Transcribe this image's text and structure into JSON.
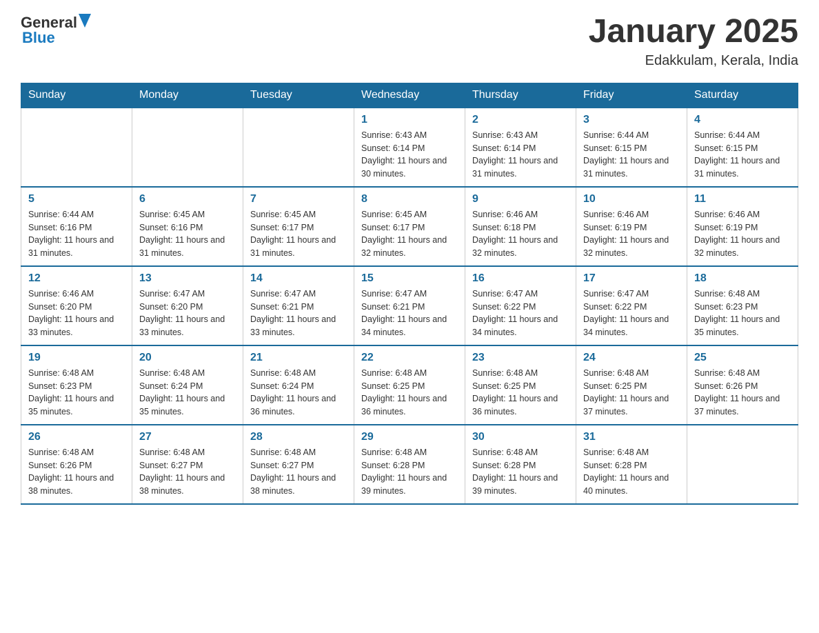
{
  "header": {
    "logo_general": "General",
    "logo_blue": "Blue",
    "month_title": "January 2025",
    "location": "Edakkulam, Kerala, India"
  },
  "days_of_week": [
    "Sunday",
    "Monday",
    "Tuesday",
    "Wednesday",
    "Thursday",
    "Friday",
    "Saturday"
  ],
  "weeks": [
    [
      {
        "day": null
      },
      {
        "day": null
      },
      {
        "day": null
      },
      {
        "day": "1",
        "sunrise": "6:43 AM",
        "sunset": "6:14 PM",
        "daylight": "11 hours and 30 minutes."
      },
      {
        "day": "2",
        "sunrise": "6:43 AM",
        "sunset": "6:14 PM",
        "daylight": "11 hours and 31 minutes."
      },
      {
        "day": "3",
        "sunrise": "6:44 AM",
        "sunset": "6:15 PM",
        "daylight": "11 hours and 31 minutes."
      },
      {
        "day": "4",
        "sunrise": "6:44 AM",
        "sunset": "6:15 PM",
        "daylight": "11 hours and 31 minutes."
      }
    ],
    [
      {
        "day": "5",
        "sunrise": "6:44 AM",
        "sunset": "6:16 PM",
        "daylight": "11 hours and 31 minutes."
      },
      {
        "day": "6",
        "sunrise": "6:45 AM",
        "sunset": "6:16 PM",
        "daylight": "11 hours and 31 minutes."
      },
      {
        "day": "7",
        "sunrise": "6:45 AM",
        "sunset": "6:17 PM",
        "daylight": "11 hours and 31 minutes."
      },
      {
        "day": "8",
        "sunrise": "6:45 AM",
        "sunset": "6:17 PM",
        "daylight": "11 hours and 32 minutes."
      },
      {
        "day": "9",
        "sunrise": "6:46 AM",
        "sunset": "6:18 PM",
        "daylight": "11 hours and 32 minutes."
      },
      {
        "day": "10",
        "sunrise": "6:46 AM",
        "sunset": "6:19 PM",
        "daylight": "11 hours and 32 minutes."
      },
      {
        "day": "11",
        "sunrise": "6:46 AM",
        "sunset": "6:19 PM",
        "daylight": "11 hours and 32 minutes."
      }
    ],
    [
      {
        "day": "12",
        "sunrise": "6:46 AM",
        "sunset": "6:20 PM",
        "daylight": "11 hours and 33 minutes."
      },
      {
        "day": "13",
        "sunrise": "6:47 AM",
        "sunset": "6:20 PM",
        "daylight": "11 hours and 33 minutes."
      },
      {
        "day": "14",
        "sunrise": "6:47 AM",
        "sunset": "6:21 PM",
        "daylight": "11 hours and 33 minutes."
      },
      {
        "day": "15",
        "sunrise": "6:47 AM",
        "sunset": "6:21 PM",
        "daylight": "11 hours and 34 minutes."
      },
      {
        "day": "16",
        "sunrise": "6:47 AM",
        "sunset": "6:22 PM",
        "daylight": "11 hours and 34 minutes."
      },
      {
        "day": "17",
        "sunrise": "6:47 AM",
        "sunset": "6:22 PM",
        "daylight": "11 hours and 34 minutes."
      },
      {
        "day": "18",
        "sunrise": "6:48 AM",
        "sunset": "6:23 PM",
        "daylight": "11 hours and 35 minutes."
      }
    ],
    [
      {
        "day": "19",
        "sunrise": "6:48 AM",
        "sunset": "6:23 PM",
        "daylight": "11 hours and 35 minutes."
      },
      {
        "day": "20",
        "sunrise": "6:48 AM",
        "sunset": "6:24 PM",
        "daylight": "11 hours and 35 minutes."
      },
      {
        "day": "21",
        "sunrise": "6:48 AM",
        "sunset": "6:24 PM",
        "daylight": "11 hours and 36 minutes."
      },
      {
        "day": "22",
        "sunrise": "6:48 AM",
        "sunset": "6:25 PM",
        "daylight": "11 hours and 36 minutes."
      },
      {
        "day": "23",
        "sunrise": "6:48 AM",
        "sunset": "6:25 PM",
        "daylight": "11 hours and 36 minutes."
      },
      {
        "day": "24",
        "sunrise": "6:48 AM",
        "sunset": "6:25 PM",
        "daylight": "11 hours and 37 minutes."
      },
      {
        "day": "25",
        "sunrise": "6:48 AM",
        "sunset": "6:26 PM",
        "daylight": "11 hours and 37 minutes."
      }
    ],
    [
      {
        "day": "26",
        "sunrise": "6:48 AM",
        "sunset": "6:26 PM",
        "daylight": "11 hours and 38 minutes."
      },
      {
        "day": "27",
        "sunrise": "6:48 AM",
        "sunset": "6:27 PM",
        "daylight": "11 hours and 38 minutes."
      },
      {
        "day": "28",
        "sunrise": "6:48 AM",
        "sunset": "6:27 PM",
        "daylight": "11 hours and 38 minutes."
      },
      {
        "day": "29",
        "sunrise": "6:48 AM",
        "sunset": "6:28 PM",
        "daylight": "11 hours and 39 minutes."
      },
      {
        "day": "30",
        "sunrise": "6:48 AM",
        "sunset": "6:28 PM",
        "daylight": "11 hours and 39 minutes."
      },
      {
        "day": "31",
        "sunrise": "6:48 AM",
        "sunset": "6:28 PM",
        "daylight": "11 hours and 40 minutes."
      },
      {
        "day": null
      }
    ]
  ]
}
